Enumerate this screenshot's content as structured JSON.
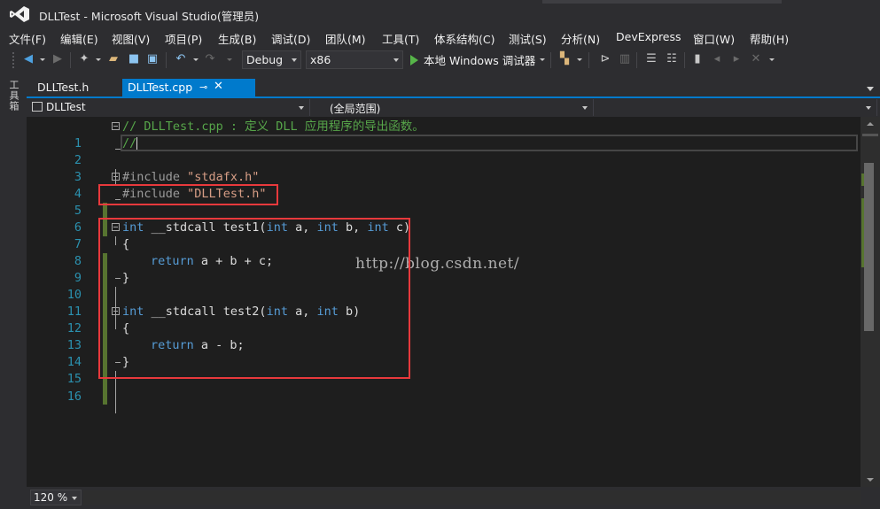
{
  "window": {
    "title": "DLLTest - Microsoft Visual Studio(管理员)"
  },
  "menu": [
    "文件(F)",
    "编辑(E)",
    "视图(V)",
    "项目(P)",
    "生成(B)",
    "调试(D)",
    "团队(M)",
    "工具(T)",
    "体系结构(C)",
    "测试(S)",
    "分析(N)",
    "DevExpress",
    "窗口(W)",
    "帮助(H)"
  ],
  "toolbar": {
    "config": "Debug",
    "platform": "x86",
    "run_label": "本地 Windows 调试器"
  },
  "side_panel": {
    "label": "工具箱"
  },
  "tabs": [
    {
      "label": "DLLTest.h",
      "active": false
    },
    {
      "label": "DLLTest.cpp",
      "active": true
    }
  ],
  "nav": {
    "project": "DLLTest",
    "scope": "(全局范围)"
  },
  "code": {
    "line_numbers": [
      "1",
      "2",
      "3",
      "4",
      "5",
      "6",
      "7",
      "8",
      "9",
      "10",
      "11",
      "12",
      "13",
      "14",
      "15",
      "16"
    ],
    "l1": "// DLLTest.cpp : 定义 DLL 应用程序的导出函数。",
    "l2": "//",
    "l4a": "#include ",
    "l4b": "\"stdafx.h\"",
    "l5a": "#include ",
    "l5b": "\"DLLTest.h\"",
    "kw_int": "int",
    "stdcall": " __stdcall ",
    "fn1": "test1(",
    "fn2": "test2(",
    "p_a": " a, ",
    "p_b1": " b, ",
    "p_c": " c)",
    "p_b2": " b)",
    "open_brace": "{",
    "close_brace": "}",
    "kw_return": "return",
    "ret1": " a + b + c;",
    "ret2": " a - b;"
  },
  "watermark": "http://blog.csdn.net/",
  "status": {
    "zoom": "120 %"
  },
  "colors": {
    "accent": "#007acc",
    "keyword": "#569cd6",
    "comment": "#57a64a",
    "string": "#d69d85",
    "preprocessor": "#9b9b9b",
    "line_number": "#2b91af",
    "highlight_box": "#e8393c",
    "change_marker": "#577430"
  }
}
